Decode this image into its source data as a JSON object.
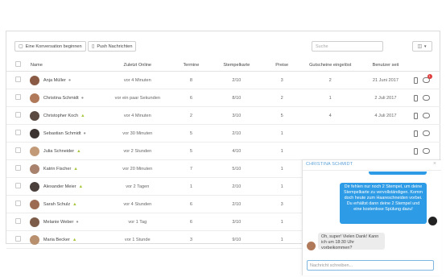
{
  "toolbar": {
    "new_conversation_label": "Eine Konversation beginnen",
    "push_label": "Push Nachrichten",
    "search_placeholder": "Suche",
    "columns_icon": "columns-icon"
  },
  "table": {
    "headers": [
      "Name",
      "Zuletzt Online",
      "Termine",
      "Stempelkarte",
      "Preise",
      "Gutscheine eingelöst",
      "Benutzer seit"
    ],
    "rows": [
      {
        "name": "Anja Müller",
        "os": "apple",
        "last_online": "vor 4 Minuten",
        "termine": "8",
        "stempelkarte": "2/10",
        "preise": "3",
        "gutscheine": "2",
        "seit": "21 Juni 2017",
        "unread": "1",
        "avatar_color": "#8a5a44"
      },
      {
        "name": "Christina Schmidt",
        "os": "apple",
        "last_online": "vor ein paar Sekunden",
        "termine": "6",
        "stempelkarte": "8/10",
        "preise": "2",
        "gutscheine": "1",
        "seit": "2 Juli 2017",
        "unread": "",
        "avatar_color": "#b07a5a"
      },
      {
        "name": "Christopher Koch",
        "os": "android",
        "last_online": "vor 4 Minuten",
        "termine": "2",
        "stempelkarte": "3/10",
        "preise": "5",
        "gutscheine": "4",
        "seit": "4 Juli 2017",
        "unread": "",
        "avatar_color": "#5b4a42"
      },
      {
        "name": "Sebastian Schmidt",
        "os": "apple",
        "last_online": "vor 30 Minuten",
        "termine": "5",
        "stempelkarte": "2/10",
        "preise": "1",
        "gutscheine": "",
        "seit": "",
        "unread": "",
        "avatar_color": "#3c3430"
      },
      {
        "name": "Julia Schneider",
        "os": "android",
        "last_online": "vor 2 Stunden",
        "termine": "5",
        "stempelkarte": "4/10",
        "preise": "1",
        "gutscheine": "",
        "seit": "",
        "unread": "",
        "avatar_color": "#c39a78"
      },
      {
        "name": "Katrin Fischer",
        "os": "android",
        "last_online": "vor 20 Minuten",
        "termine": "7",
        "stempelkarte": "5/10",
        "preise": "1",
        "gutscheine": "",
        "seit": "",
        "unread": "",
        "avatar_color": "#a8826c"
      },
      {
        "name": "Alexander Meier",
        "os": "android",
        "last_online": "vor 2 Tagen",
        "termine": "1",
        "stempelkarte": "2/10",
        "preise": "1",
        "gutscheine": "",
        "seit": "",
        "unread": "",
        "avatar_color": "#4a3f3a"
      },
      {
        "name": "Sarah Schulz",
        "os": "android",
        "last_online": "vor 4 Stunden",
        "termine": "6",
        "stempelkarte": "2/10",
        "preise": "3",
        "gutscheine": "",
        "seit": "",
        "unread": "",
        "avatar_color": "#9c6b52"
      },
      {
        "name": "Melanie Weber",
        "os": "apple",
        "last_online": "vor 1 Tag",
        "termine": "6",
        "stempelkarte": "3/10",
        "preise": "1",
        "gutscheine": "",
        "seit": "",
        "unread": "",
        "avatar_color": "#7d5c4a"
      },
      {
        "name": "Maria Becker",
        "os": "android",
        "last_online": "vor 1 Stunde",
        "termine": "3",
        "stempelkarte": "9/10",
        "preise": "1",
        "gutscheine": "",
        "seit": "",
        "unread": "",
        "avatar_color": "#b8906e"
      }
    ]
  },
  "chat": {
    "title": "CHRISTINA SCHMIDT",
    "outgoing": "Dir fehlen nur noch 2 Stempel, um deine Stempelkarte zu vervollständigen. Komm doch heute zum Haareschneiden vorbei. Du erhältst dann deine 2 Stempel und eine kostenlose Spülung dazu!",
    "incoming": "Oh, super! Vielen Dank! Kann ich um 18:30 Uhr vorbeikommen?",
    "input_placeholder": "Nachricht schreiben..."
  },
  "colors": {
    "accent": "#2d9be5",
    "badge": "#e03b3b",
    "android": "#a4c639"
  }
}
